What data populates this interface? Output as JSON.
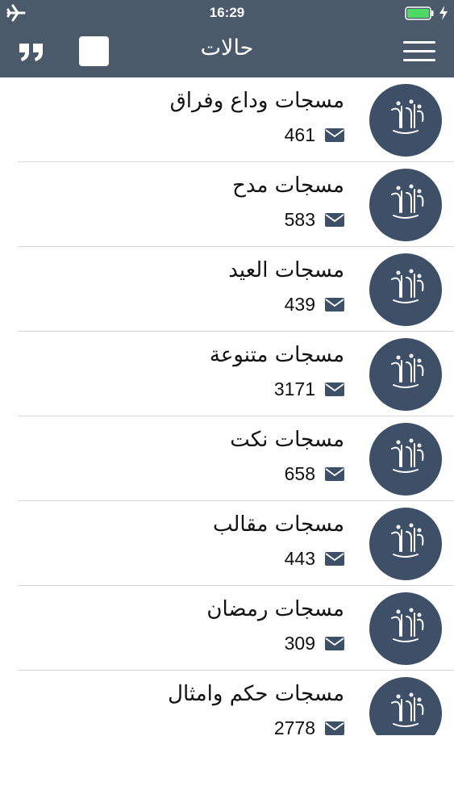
{
  "status_bar": {
    "time": "16:29"
  },
  "nav": {
    "title": "حالات"
  },
  "list": {
    "items": [
      {
        "title": "مسجات وداع وفراق",
        "count": "461"
      },
      {
        "title": "مسجات مدح",
        "count": "583"
      },
      {
        "title": "مسجات العيد",
        "count": "439"
      },
      {
        "title": "مسجات متنوعة",
        "count": "3171"
      },
      {
        "title": "مسجات نكت",
        "count": "658"
      },
      {
        "title": "مسجات مقالب",
        "count": "443"
      },
      {
        "title": "مسجات رمضان",
        "count": "309"
      },
      {
        "title": "مسجات حكم وامثال",
        "count": "2778"
      }
    ]
  },
  "colors": {
    "header": "#4a5a6a",
    "avatar": "#3d5068",
    "battery": "#4cd964"
  }
}
